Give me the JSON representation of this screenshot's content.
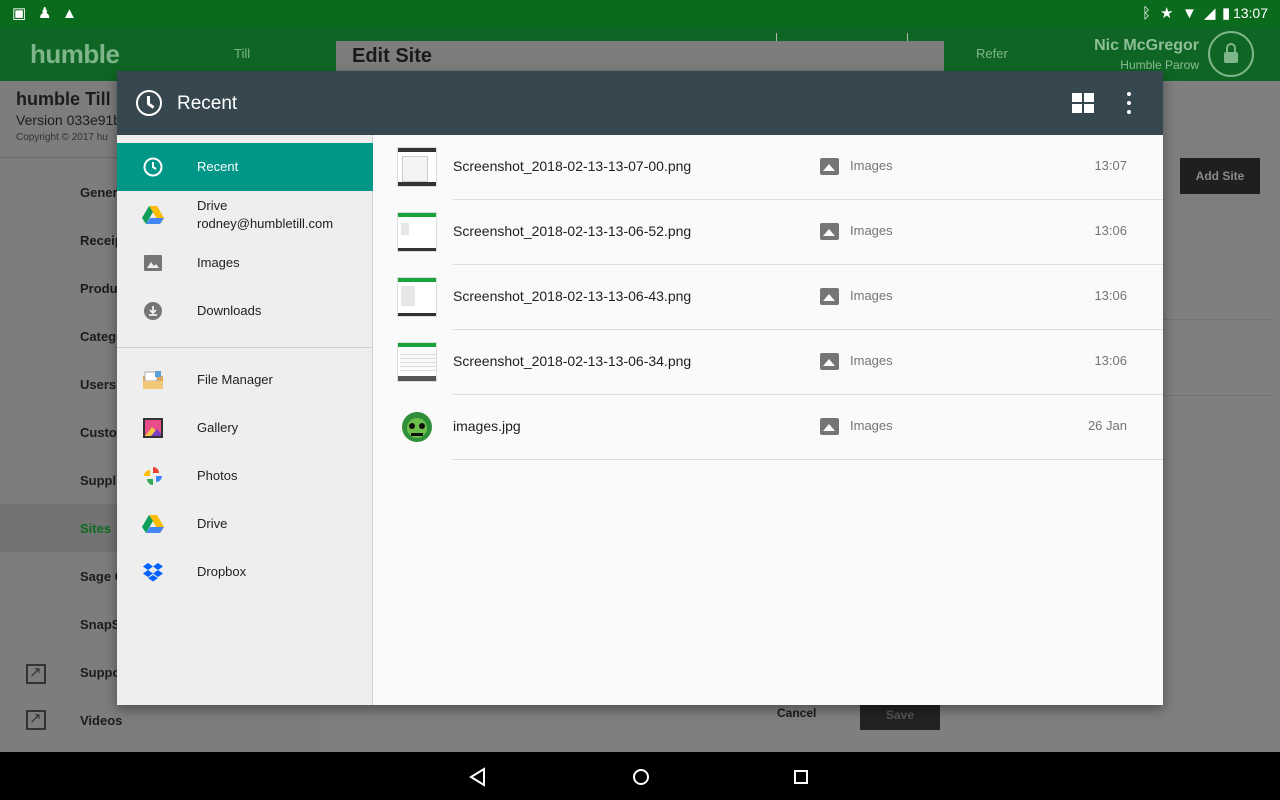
{
  "status_bar": {
    "time": "13:07"
  },
  "app": {
    "brand": "humble",
    "nav_left": "Till",
    "nav_right": "Refer",
    "user_name": "Nic McGregor",
    "user_site": "Humble Parow",
    "side_title": "humble Till",
    "side_version": "Version 033e91b",
    "side_copyright": "Copyright © 2017 hu",
    "side_items": [
      "Genera",
      "Receip",
      "Produc",
      "Catego",
      "Users",
      "Custor",
      "Supplie",
      "Sites",
      "Sage C",
      "SnapS",
      "Suppo",
      "Videos"
    ],
    "active_item": "Sites",
    "add_site_label": "Add Site"
  },
  "edit_dialog": {
    "title": "Edit Site",
    "cancel_label": "Cancel",
    "save_label": "Save"
  },
  "picker": {
    "title": "Recent",
    "roots": [
      {
        "label": "Recent",
        "icon": "clock-icon",
        "active": true
      },
      {
        "label": "Drive",
        "sublabel": "rodney@humbletill.com",
        "icon": "google-drive-icon"
      },
      {
        "label": "Images",
        "icon": "image-icon"
      },
      {
        "label": "Downloads",
        "icon": "download-icon"
      },
      {
        "label": "File Manager",
        "icon": "file-manager-icon"
      },
      {
        "label": "Gallery",
        "icon": "gallery-icon"
      },
      {
        "label": "Photos",
        "icon": "google-photos-icon"
      },
      {
        "label": "Drive",
        "icon": "google-drive-icon"
      },
      {
        "label": "Dropbox",
        "icon": "dropbox-icon"
      }
    ],
    "documents": [
      {
        "name": "Screenshot_2018-02-13-13-07-00.png",
        "type": "Images",
        "date": "13:07"
      },
      {
        "name": "Screenshot_2018-02-13-13-06-52.png",
        "type": "Images",
        "date": "13:06"
      },
      {
        "name": "Screenshot_2018-02-13-13-06-43.png",
        "type": "Images",
        "date": "13:06"
      },
      {
        "name": "Screenshot_2018-02-13-13-06-34.png",
        "type": "Images",
        "date": "13:06"
      },
      {
        "name": "images.jpg",
        "type": "Images",
        "date": "26 Jan"
      }
    ]
  },
  "colors": {
    "accent": "#009688",
    "toolbar": "#37474f",
    "status_bar": "#0b6b1d"
  }
}
